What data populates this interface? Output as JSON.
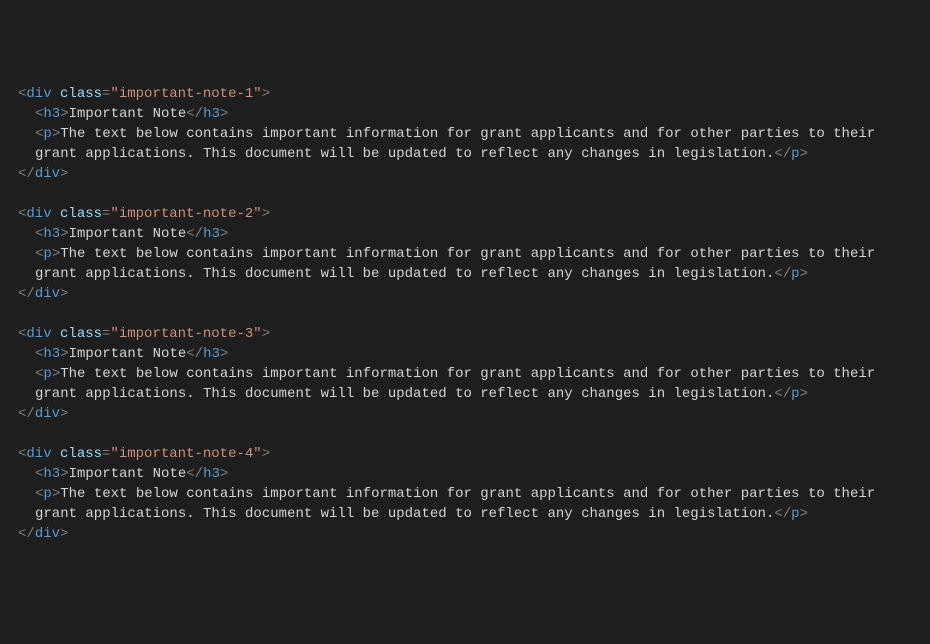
{
  "blocks": [
    {
      "className": "important-note-1",
      "heading": "Important Note",
      "paraLine1": "The text below contains important information for grant applicants and for other parties to their",
      "paraLine2": "grant applications. This document will be updated to reflect any changes in legislation."
    },
    {
      "className": "important-note-2",
      "heading": "Important Note",
      "paraLine1": "The text below contains important information for grant applicants and for other parties to their",
      "paraLine2": "grant applications. This document will be updated to reflect any changes in legislation."
    },
    {
      "className": "important-note-3",
      "heading": "Important Note",
      "paraLine1": "The text below contains important information for grant applicants and for other parties to their",
      "paraLine2": "grant applications. This document will be updated to reflect any changes in legislation."
    },
    {
      "className": "important-note-4",
      "heading": "Important Note",
      "paraLine1": "The text below contains important information for grant applicants and for other parties to their",
      "paraLine2": "grant applications. This document will be updated to reflect any changes in legislation."
    }
  ],
  "tokens": {
    "lt": "<",
    "gt": ">",
    "ltSlash": "</",
    "div": "div",
    "h3": "h3",
    "p": "p",
    "class": "class",
    "eq": "=",
    "q": "\""
  }
}
